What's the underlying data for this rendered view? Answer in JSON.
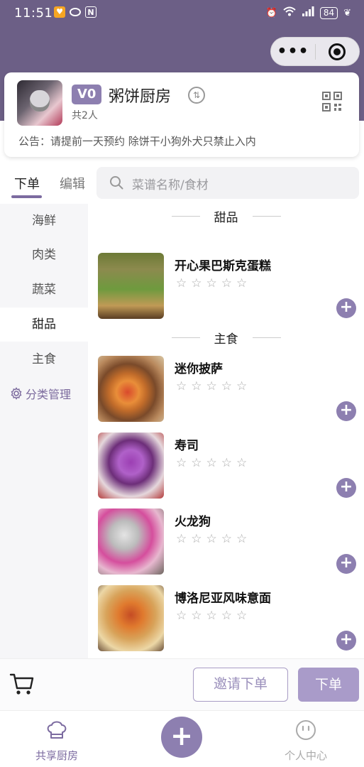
{
  "status_bar": {
    "time": "11:51",
    "battery": "84"
  },
  "capsule": {
    "menu_label": "•••"
  },
  "kitchen": {
    "level_badge": "V0",
    "name": "粥饼厨房",
    "member_count": "共2人",
    "notice": "公告：请提前一天预约 除饼干小狗外犬只禁止入内"
  },
  "tabs": {
    "order": "下单",
    "edit": "编辑"
  },
  "search": {
    "placeholder": "菜谱名称/食材"
  },
  "sidebar": {
    "categories": [
      {
        "label": "海鲜"
      },
      {
        "label": "肉类"
      },
      {
        "label": "蔬菜"
      },
      {
        "label": "甜品"
      },
      {
        "label": "主食"
      }
    ],
    "active": "甜品",
    "manage_label": "分类管理"
  },
  "sections": [
    {
      "title": "甜品",
      "dishes": [
        {
          "name": "开心果巴斯克蛋糕",
          "rating": "☆☆☆☆☆",
          "image": "pistachio-basque-cake"
        }
      ]
    },
    {
      "title": "主食",
      "dishes": [
        {
          "name": "迷你披萨",
          "rating": "☆☆☆☆☆",
          "image": "mini-pizza"
        },
        {
          "name": "寿司",
          "rating": "☆☆☆☆☆",
          "image": "sushi"
        },
        {
          "name": "火龙狗",
          "rating": "☆☆☆☆☆",
          "image": "dragon-dog"
        },
        {
          "name": "博洛尼亚风味意面",
          "rating": "☆☆☆☆☆",
          "image": "bolognese-pasta"
        }
      ]
    }
  ],
  "action_bar": {
    "invite_label": "邀请下单",
    "order_label": "下单"
  },
  "tabbar": {
    "shared_kitchen": "共享厨房",
    "center_plus": "+",
    "profile": "个人中心"
  },
  "colors": {
    "header_purple": "#6c5f86",
    "accent_purple": "#8d7fb0",
    "light_purple": "#a99bc9"
  }
}
